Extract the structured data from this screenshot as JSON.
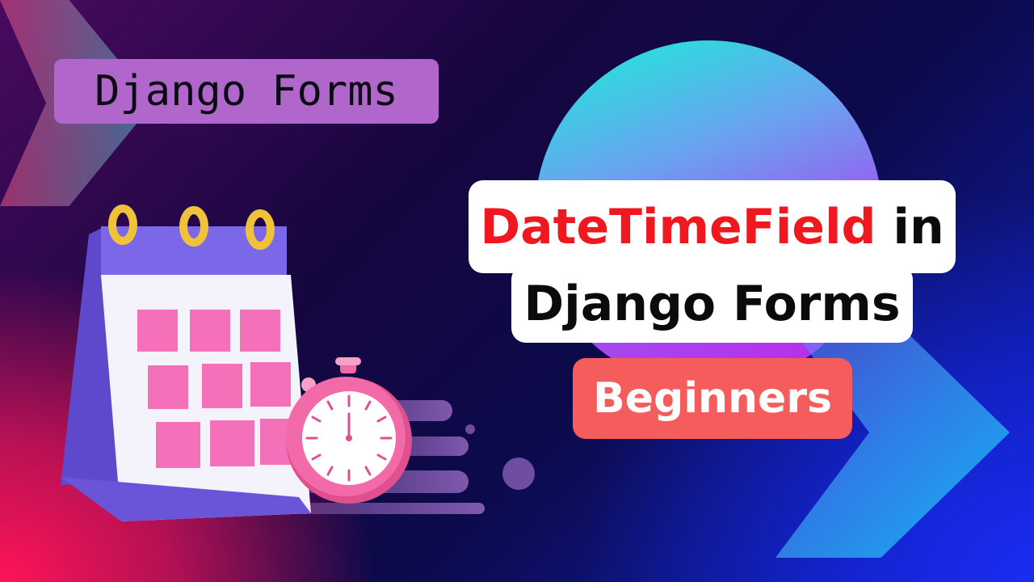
{
  "thumbnail": {
    "series_label": "Django Forms",
    "title_line1_accent": "DateTimeField",
    "title_line1_rest": "in",
    "title_line2": "Django Forms",
    "level_label": "Beginners"
  },
  "colors": {
    "accent_red": "#f0181f",
    "badge_purple": "#b166cc",
    "badge_coral": "#f55c5c",
    "calendar_header": "#7a68e8",
    "calendar_cell": "#f470b8",
    "stopwatch_body": "#f36aa9"
  },
  "icons": {
    "calendar": "calendar-icon",
    "stopwatch": "stopwatch-icon"
  }
}
